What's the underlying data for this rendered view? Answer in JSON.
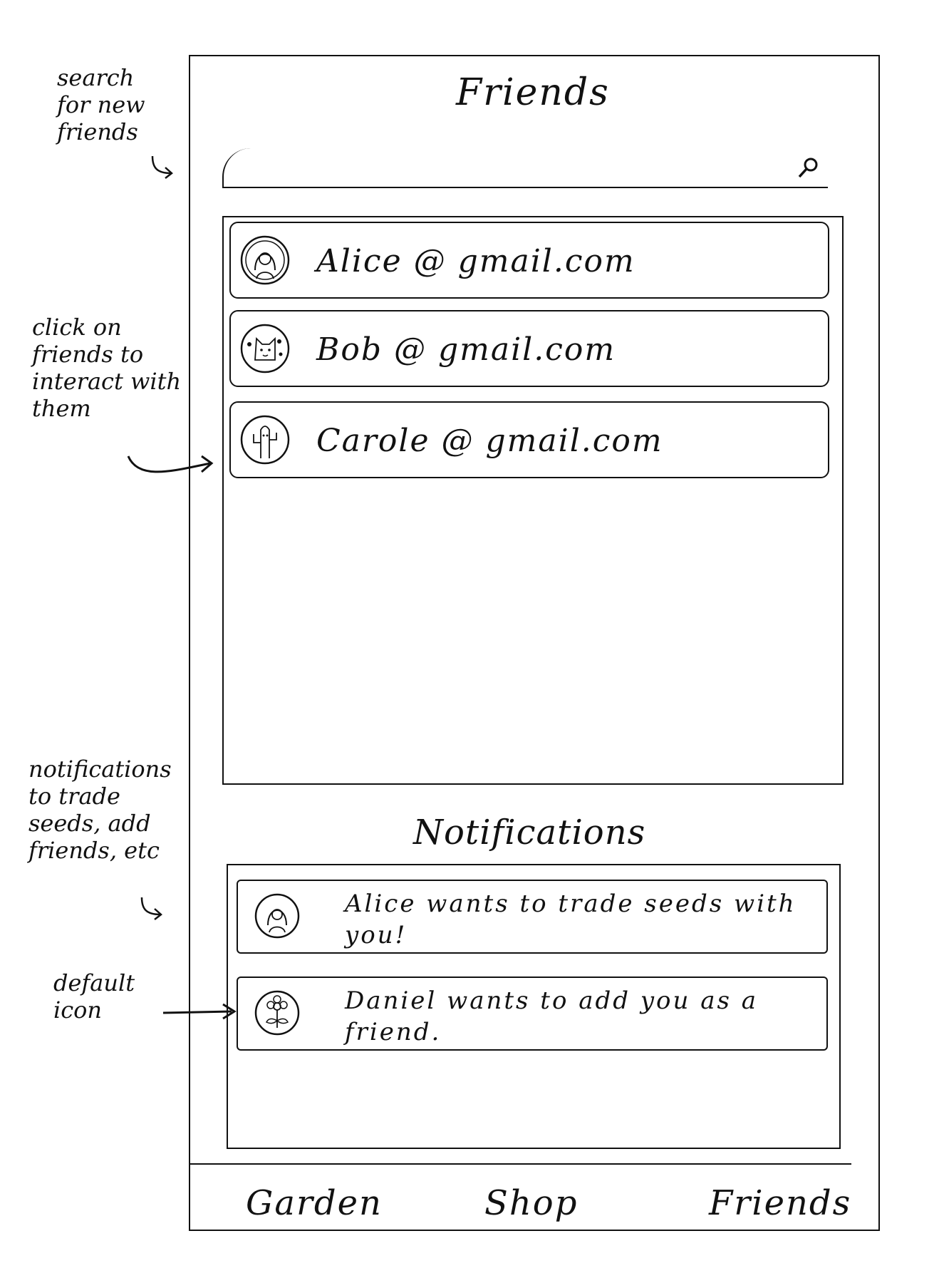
{
  "screen": {
    "title": "Friends",
    "search": {
      "value": "",
      "placeholder": ""
    },
    "friends": [
      {
        "email": "Alice @ gmail.com",
        "avatar": "woman-avatar-icon"
      },
      {
        "email": "Bob @ gmail.com",
        "avatar": "cat-avatar-icon"
      },
      {
        "email": "Carole @ gmail.com",
        "avatar": "cactus-avatar-icon"
      }
    ],
    "notifications_title": "Notifications",
    "notifications": [
      {
        "message": "Alice wants to trade seeds with you!",
        "avatar": "woman-avatar-icon"
      },
      {
        "message": "Daniel wants to add you as a friend.",
        "avatar": "flower-default-icon"
      }
    ],
    "nav": [
      "Garden",
      "Shop",
      "Friends"
    ]
  },
  "annotations": {
    "search": "search for new friends",
    "friends": "click on friends to interact with them",
    "notifications": "notifications to trade seeds, add friends, etc",
    "default_icon": "default icon"
  }
}
